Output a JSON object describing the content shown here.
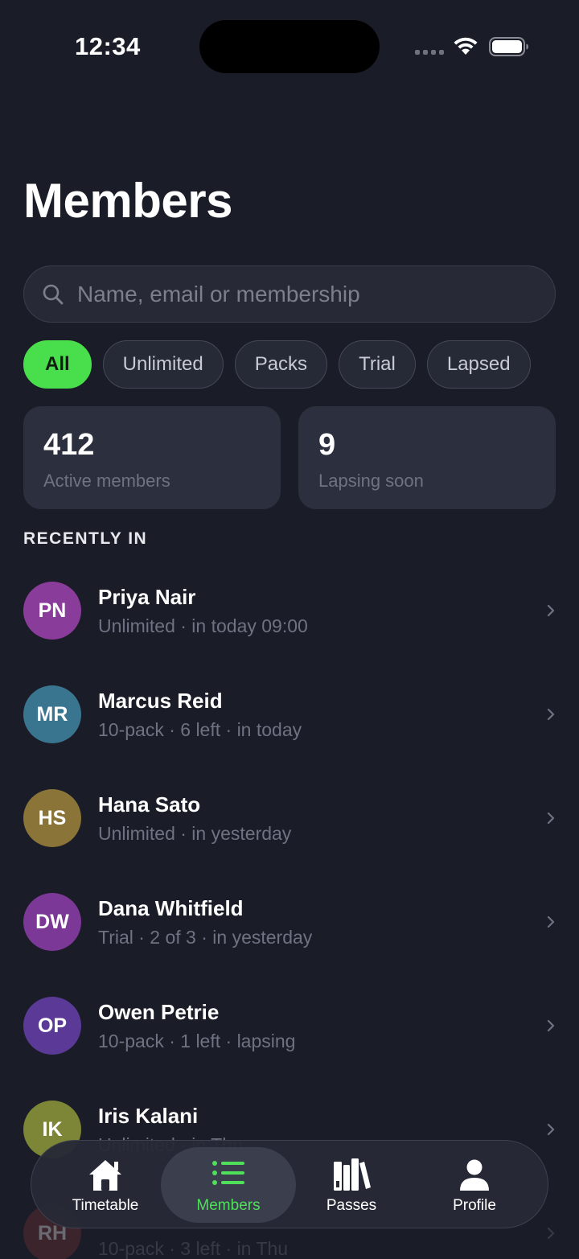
{
  "status_bar": {
    "time": "12:34"
  },
  "header": {
    "title": "Members"
  },
  "search": {
    "placeholder": "Name, email or membership"
  },
  "filters": [
    {
      "label": "All",
      "active": true
    },
    {
      "label": "Unlimited",
      "active": false
    },
    {
      "label": "Packs",
      "active": false
    },
    {
      "label": "Trial",
      "active": false
    },
    {
      "label": "Lapsed",
      "active": false
    }
  ],
  "stats": [
    {
      "value": "412",
      "label": "Active members"
    },
    {
      "value": "9",
      "label": "Lapsing soon"
    }
  ],
  "section": {
    "title": "RECENTLY IN"
  },
  "members": [
    {
      "initials": "PN",
      "name": "Priya Nair",
      "detail": "Unlimited · in today 09:00",
      "color": "#8a3c9a"
    },
    {
      "initials": "MR",
      "name": "Marcus Reid",
      "detail": "10-pack · 6 left · in today",
      "color": "#3a7590"
    },
    {
      "initials": "HS",
      "name": "Hana Sato",
      "detail": "Unlimited · in yesterday",
      "color": "#8a7437"
    },
    {
      "initials": "DW",
      "name": "Dana Whitfield",
      "detail": "Trial · 2 of 3 · in yesterday",
      "color": "#7b3896"
    },
    {
      "initials": "OP",
      "name": "Owen Petrie",
      "detail": "10-pack · 1 left · lapsing",
      "color": "#5a3a96"
    },
    {
      "initials": "IK",
      "name": "Iris Kalani",
      "detail": "Unlimited · in Thu",
      "color": "#7d8537"
    },
    {
      "initials": "RH",
      "name": "",
      "detail": "10-pack · 3 left · in Thu",
      "color": "#7a3434"
    }
  ],
  "tabs": [
    {
      "label": "Timetable",
      "icon": "house-icon",
      "active": false
    },
    {
      "label": "Members",
      "icon": "list-icon",
      "active": true
    },
    {
      "label": "Passes",
      "icon": "books-icon",
      "active": false
    },
    {
      "label": "Profile",
      "icon": "person-icon",
      "active": false
    }
  ],
  "colors": {
    "accent": "#48de4c",
    "background": "#1a1c27",
    "card": "#2c303e"
  }
}
